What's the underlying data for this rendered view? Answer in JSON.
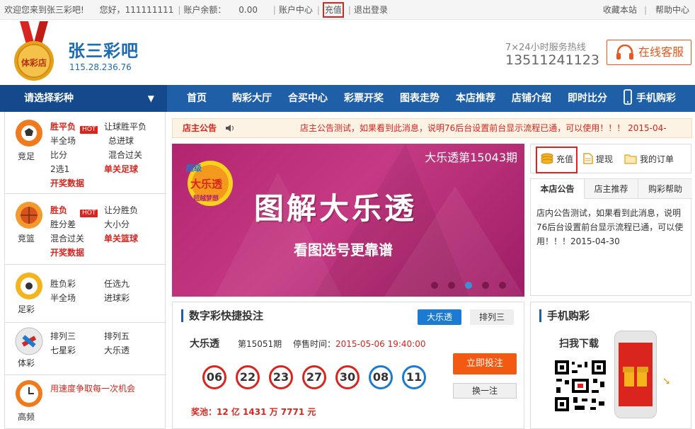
{
  "topbar": {
    "welcome": "欢迎您来到张三彩吧!",
    "greeting": "您好，111111111",
    "balance_label": "账户余额：",
    "balance_value": "0.00",
    "account_center": "账户中心",
    "recharge": "充值",
    "logout": "退出登录",
    "bookmark": "收藏本站",
    "help": "帮助中心"
  },
  "header": {
    "medal_text": "体彩店",
    "site_name": "张三彩吧",
    "site_ip": "115.28.236.76",
    "hotline_label": "7×24小时服务热线",
    "hotline_number": "13511241123",
    "service_label": "在线客服"
  },
  "nav": {
    "picker": "请选择彩种",
    "items": [
      "首页",
      "购彩大厅",
      "合买中心",
      "彩票开奖",
      "图表走势",
      "本店推荐",
      "店铺介绍",
      "即时比分",
      "手机购彩"
    ]
  },
  "sidebar": {
    "football": {
      "name": "竞足",
      "a": "胜平负",
      "hot": "HOT",
      "b": "让球胜平负",
      "c": "半全场",
      "d": "总进球",
      "e": "比分",
      "f": "混合过关",
      "g": "2选1",
      "h": "单关足球",
      "i": "开奖数据"
    },
    "basketball": {
      "name": "竞篮",
      "a": "胜负",
      "hot": "HOT",
      "b": "让分胜负",
      "c": "胜分差",
      "d": "大小分",
      "e": "混合过关",
      "f": "单关篮球",
      "g": "开奖数据"
    },
    "zucai": {
      "name": "足彩",
      "a": "胜负彩",
      "b": "任选九",
      "c": "半全场",
      "d": "进球彩"
    },
    "ticai": {
      "name": "体彩",
      "a": "排列三",
      "b": "排列五",
      "c": "七星彩",
      "d": "大乐透"
    },
    "gaopin": {
      "name": "高频",
      "a": "用速度争取每一次机会"
    }
  },
  "notice": {
    "label": "店主公告",
    "text": "店主公告测试，如果看到此消息，说明76后台设置前台显示流程已通，可以使用！！！ 2015-04-"
  },
  "banner": {
    "period": "大乐透第15043期",
    "headline": "图解大乐透",
    "subline": "看图选号更靠谱",
    "logo_top": "超级",
    "logo_main": "大乐透",
    "logo_bottom": "超越梦想",
    "dots": 5,
    "active_dot": 3
  },
  "account": {
    "recharge": "充值",
    "withdraw": "提现",
    "orders": "我的订单"
  },
  "tabs": {
    "items": [
      "本店公告",
      "店主推荐",
      "购彩帮助"
    ],
    "content": "店内公告测试，如果看到此消息，说明76后台设置前台显示流程已通，可以使用！！！2015-04-30"
  },
  "quick": {
    "title": "数字彩快捷投注",
    "tab_active": "大乐透",
    "tab_other": "排列三",
    "game": "大乐透",
    "issue": "第15051期",
    "stop_label": "停售时间：",
    "stop_time": "2015-05-06 19:40:00",
    "red_balls": [
      "06",
      "22",
      "23",
      "27",
      "30"
    ],
    "blue_balls": [
      "08",
      "11"
    ],
    "bet_button": "立即投注",
    "change_button": "换一注",
    "pool": "奖池：12 亿 1431 万 7771 元"
  },
  "mobile": {
    "title": "手机购彩",
    "scan": "扫我下载"
  },
  "colors": {
    "nav_blue": "#1e5fa8",
    "accent_red": "#d9251d",
    "bet_orange": "#f25a12",
    "ball_blue": "#1b7ad1"
  }
}
